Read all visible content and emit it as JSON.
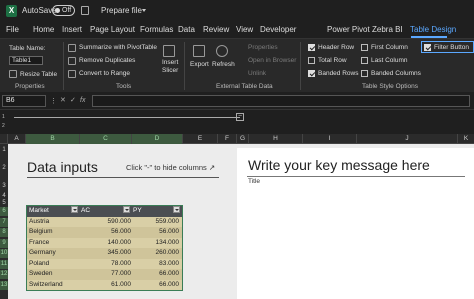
{
  "titlebar": {
    "app_letter": "X",
    "autosave": "AutoSave",
    "toggle": "Off",
    "prepare": "Prepare file"
  },
  "tabs": [
    "File",
    "Home",
    "Insert",
    "Page Layout",
    "Formulas",
    "Data",
    "Review",
    "View",
    "Developer",
    "Power Pivot",
    "Zebra BI",
    "Table Design"
  ],
  "ribbon": {
    "table_name_label": "Table Name:",
    "table_name_value": "Table1",
    "resize": "Resize Table",
    "properties_group": "Properties",
    "summarize": "Summarize with PivotTable",
    "remove_dup": "Remove Duplicates",
    "convert": "Convert to Range",
    "tools_group": "Tools",
    "insert_slicer_1": "Insert",
    "insert_slicer_2": "Slicer",
    "export": "Export",
    "refresh": "Refresh",
    "properties2": "Properties",
    "open_browser": "Open in Browser",
    "unlink": "Unlink",
    "external_group": "External Table Data",
    "header_row": "Header Row",
    "total_row": "Total Row",
    "banded_rows": "Banded Rows",
    "first_col": "First Column",
    "last_col": "Last Column",
    "banded_cols": "Banded Columns",
    "filter_btn": "Filter Button",
    "style_group": "Table Style Options"
  },
  "formula_bar": {
    "name_box": "B6"
  },
  "columns": [
    "A",
    "B",
    "C",
    "D",
    "E",
    "F",
    "G",
    "H",
    "I",
    "J",
    "K"
  ],
  "rows": [
    "1",
    "2",
    "3",
    "4",
    "5",
    "6",
    "7",
    "8",
    "9",
    "10",
    "11",
    "12",
    "13"
  ],
  "sheet": {
    "data_inputs_title": "Data inputs",
    "hint": "Click \"-\" to hide columns ↗",
    "key_message": "Write your key message here",
    "title_label": "Title"
  },
  "table": {
    "headers": [
      "Market",
      "AC",
      "PY"
    ],
    "rows": [
      [
        "Austria",
        "590.000",
        "559.000"
      ],
      [
        "Belgium",
        "56.000",
        "56.000"
      ],
      [
        "France",
        "140.000",
        "134.000"
      ],
      [
        "Germany",
        "345.000",
        "260.000"
      ],
      [
        "Poland",
        "78.000",
        "83.000"
      ],
      [
        "Sweden",
        "77.000",
        "66.000"
      ],
      [
        "Switzerland",
        "61.000",
        "66.000"
      ]
    ]
  },
  "colors": {
    "accent": "#5ba8ff",
    "table_fill": "#d9cfa6",
    "table_border": "#3a7d56",
    "excel_green": "#1d7044"
  }
}
